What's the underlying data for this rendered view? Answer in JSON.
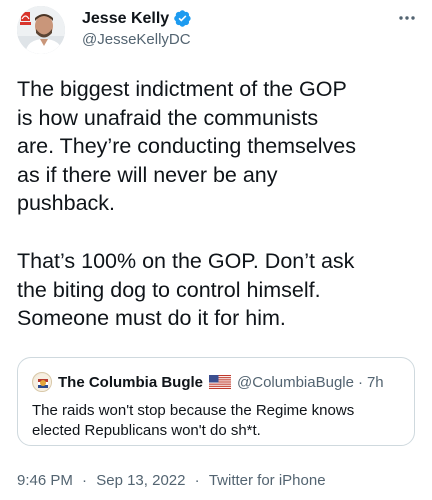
{
  "author": {
    "name": "Jesse Kelly",
    "handle": "@JesseKellyDC",
    "avatar_icon": "avatar-photo",
    "verified_icon": "verified-badge-icon"
  },
  "tweet": {
    "paragraphs": [
      "The biggest indictment of the GOP\nis how unafraid the communists\nare. They’re conducting themselves\nas if there will never be any\npushback.",
      "That’s 100% on the GOP. Don’t ask\nthe biting dog to control himself.\nSomeone must do it for him."
    ]
  },
  "quote": {
    "name": "The Columbia Bugle",
    "flag_icon": "us-flag-icon",
    "handle": "@ColumbiaBugle",
    "separator": "·",
    "time": "7h",
    "text": "The raids won't stop because the Regime knows elected Republicans won't do sh*t."
  },
  "meta": {
    "time": "9:46 PM",
    "separator": "·",
    "date": "Sep 13, 2022",
    "source": "Twitter for iPhone"
  },
  "colors": {
    "text": "#0f1419",
    "secondary": "#536471",
    "verified": "#1d9bf0",
    "border": "#cfd9de"
  }
}
